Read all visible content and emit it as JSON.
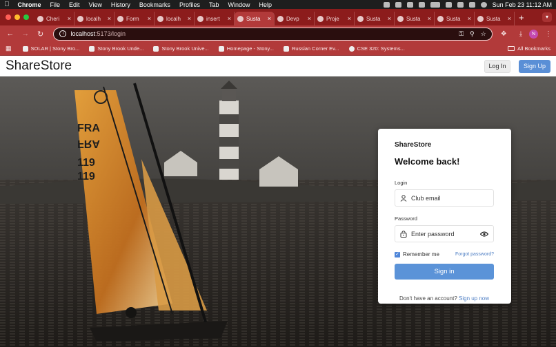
{
  "menubar": {
    "app": "Chrome",
    "items": [
      "File",
      "Edit",
      "View",
      "History",
      "Bookmarks",
      "Profiles",
      "Tab",
      "Window",
      "Help"
    ],
    "datetime": "Sun Feb 23  11:12 AM"
  },
  "tabs": [
    {
      "label": "Cheri",
      "icon": "github-icon"
    },
    {
      "label": "localh",
      "icon": "globe-icon"
    },
    {
      "label": "Form",
      "icon": "globe-icon"
    },
    {
      "label": "localh",
      "icon": "globe-icon"
    },
    {
      "label": "insert",
      "icon": "github-icon"
    },
    {
      "label": "Susta",
      "icon": "app-icon",
      "active": true
    },
    {
      "label": "Devp",
      "icon": "dev-icon"
    },
    {
      "label": "Proje",
      "icon": "project-icon"
    },
    {
      "label": "Susta",
      "icon": "app-icon"
    },
    {
      "label": "Susta",
      "icon": "app-icon"
    },
    {
      "label": "Susta",
      "icon": "app-icon"
    },
    {
      "label": "Susta",
      "icon": "app-icon"
    }
  ],
  "toolbar": {
    "url_host": "localhost",
    "url_path": ":5173/login",
    "avatar_letter": "N"
  },
  "bookmarks": {
    "items": [
      "SOLAR | Stony Bro...",
      "Stony Brook Unde...",
      "Stony Brook Unive...",
      "Homepage - Stony...",
      "Russian Corner Ev...",
      "CSE 320: Systems..."
    ],
    "all_label": "All Bookmarks"
  },
  "site": {
    "brand": "ShareStore",
    "login_label": "Log In",
    "signup_label": "Sign Up"
  },
  "card": {
    "brand": "ShareStore",
    "title": "Welcome back!",
    "login_label": "Login",
    "login_placeholder": "Club email",
    "password_label": "Password",
    "password_placeholder": "Enter password",
    "remember_label": "Remember me",
    "forgot_label": "Forgot password?",
    "signin_label": "Sign in",
    "no_account_text": "Don't have an account?",
    "signup_link": "Sign up now"
  },
  "colors": {
    "chrome_tab_strip": "#8c1c1c",
    "chrome_toolbar": "#b23a3a",
    "accent_blue": "#5b93d8"
  }
}
